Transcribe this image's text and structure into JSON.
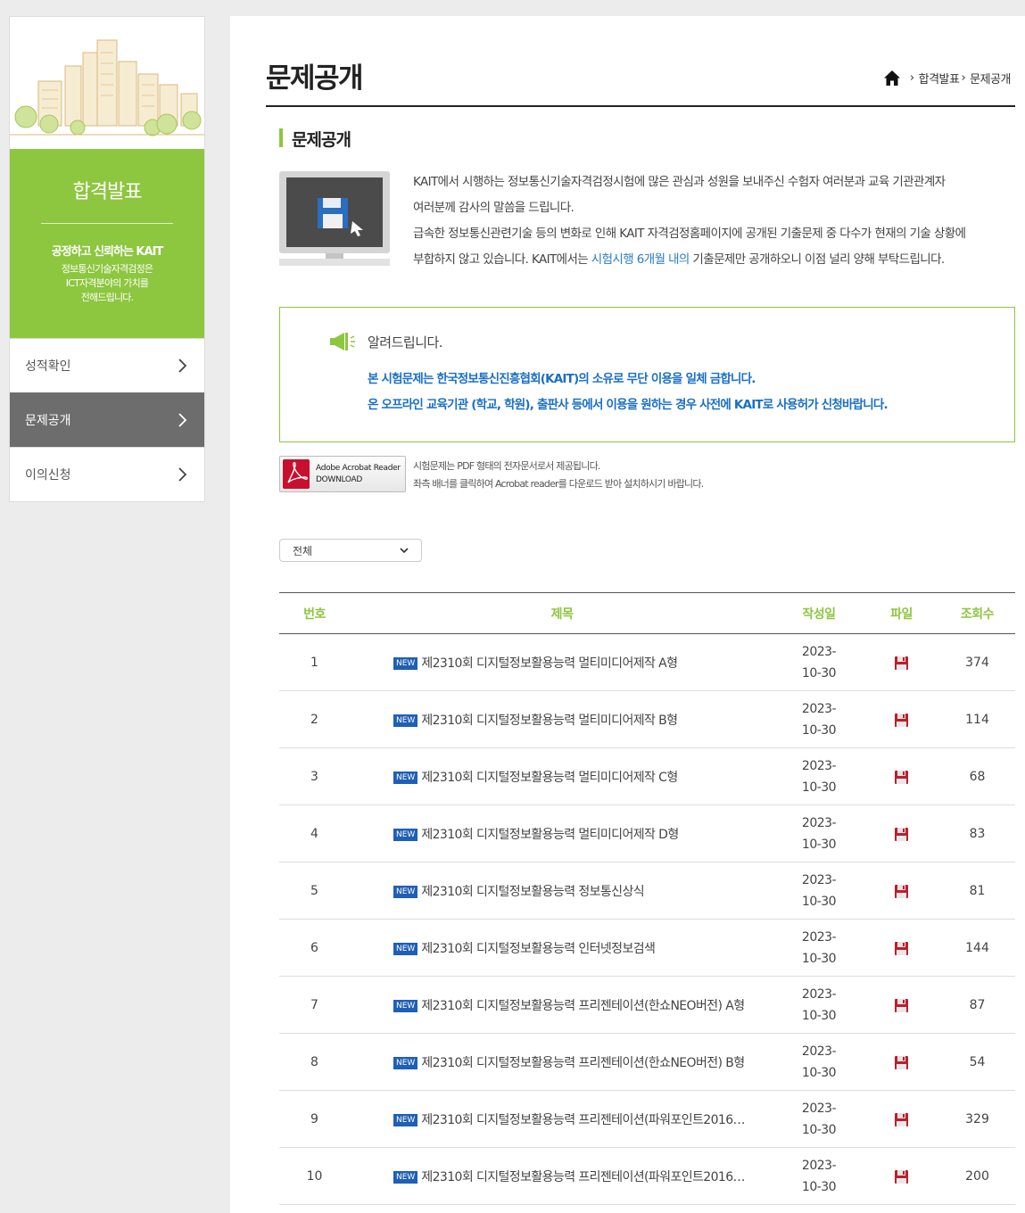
{
  "sidebar": {
    "title": "합격발표",
    "slogan": "공정하고 신뢰하는 KAIT",
    "desc_lines": [
      "정보통신기술자격검정은",
      "ICT자격분야의 가치를",
      "전해드립니다."
    ],
    "items": [
      {
        "label": "성적확인"
      },
      {
        "label": "문제공개"
      },
      {
        "label": "이의신청"
      }
    ]
  },
  "header": {
    "title": "문제공개",
    "breadcrumb": [
      "합격발표",
      "문제공개"
    ]
  },
  "section": {
    "title": "문제공개"
  },
  "intro": {
    "l1": "KAIT에서 시행하는 정보통신기술자격검정시험에 많은 관심과 성원을 보내주신 수험자 여러분과 교육 기관관계자",
    "l2": "여러분께 감사의 말씀을 드립니다.",
    "l3": "급속한 정보통신관련기술 등의 변화로 인해 KAIT 자격검정홈페이지에 공개된 기출문제 중 다수가 현재의 기술 상황에",
    "l4_a": "부합하지 않고 있습니다. KAIT에서는 ",
    "l4_link": "시험시행 6개월 내의",
    "l4_b": " 기출문제만 공개하오니 이점 널리 양해 부탁드립니다."
  },
  "notice": {
    "heading": "알려드립니다.",
    "line1": "본 시험문제는 한국정보통신진흥협회(KAIT)의 소유로 무단 이용을 일체 금합니다.",
    "line2": "온 오프라인 교육기관 (학교, 학원), 출판사 등에서 이용을 원하는 경우 사전에 KAIT로 사용허가 신청바랍니다."
  },
  "acrobat": {
    "line1": "Adobe Acrobat Reader",
    "line2": "DOWNLOAD",
    "note1": "시험문제는 PDF 형태의 전자문서로서 제공됩니다.",
    "note2": "좌측 배너를 클릭하여 Acrobat reader를 다운로드 받아 설치하시기 바랍니다."
  },
  "filter": {
    "selected": "전체"
  },
  "table": {
    "headers": {
      "no": "번호",
      "title": "제목",
      "date": "작성일",
      "file": "파일",
      "views": "조회수"
    },
    "new_badge": "NEW",
    "rows": [
      {
        "no": "1",
        "title": "제2310회 디지털정보활용능력 멀티미디어제작 A형",
        "date1": "2023-",
        "date2": "10-30",
        "views": "374"
      },
      {
        "no": "2",
        "title": "제2310회 디지털정보활용능력 멀티미디어제작 B형",
        "date1": "2023-",
        "date2": "10-30",
        "views": "114"
      },
      {
        "no": "3",
        "title": "제2310회 디지털정보활용능력 멀티미디어제작 C형",
        "date1": "2023-",
        "date2": "10-30",
        "views": "68"
      },
      {
        "no": "4",
        "title": "제2310회 디지털정보활용능력 멀티미디어제작 D형",
        "date1": "2023-",
        "date2": "10-30",
        "views": "83"
      },
      {
        "no": "5",
        "title": "제2310회 디지털정보활용능력 정보통신상식",
        "date1": "2023-",
        "date2": "10-30",
        "views": "81"
      },
      {
        "no": "6",
        "title": "제2310회 디지털정보활용능력 인터넷정보검색",
        "date1": "2023-",
        "date2": "10-30",
        "views": "144"
      },
      {
        "no": "7",
        "title": "제2310회 디지털정보활용능력 프리젠테이션(한쇼NEO버전) A형",
        "date1": "2023-",
        "date2": "10-30",
        "views": "87"
      },
      {
        "no": "8",
        "title": "제2310회 디지털정보활용능력 프리젠테이션(한쇼NEO버전) B형",
        "date1": "2023-",
        "date2": "10-30",
        "views": "54"
      },
      {
        "no": "9",
        "title": "제2310회 디지털정보활용능력 프리젠테이션(파워포인트2016…",
        "date1": "2023-",
        "date2": "10-30",
        "views": "329"
      },
      {
        "no": "10",
        "title": "제2310회 디지털정보활용능력 프리젠테이션(파워포인트2016…",
        "date1": "2023-",
        "date2": "10-30",
        "views": "200"
      }
    ]
  },
  "colors": {
    "accent_green": "#8dc63f",
    "link_blue": "#1a6fc4",
    "badge_blue": "#1f5fb6",
    "active_gray": "#6d6d6d"
  }
}
